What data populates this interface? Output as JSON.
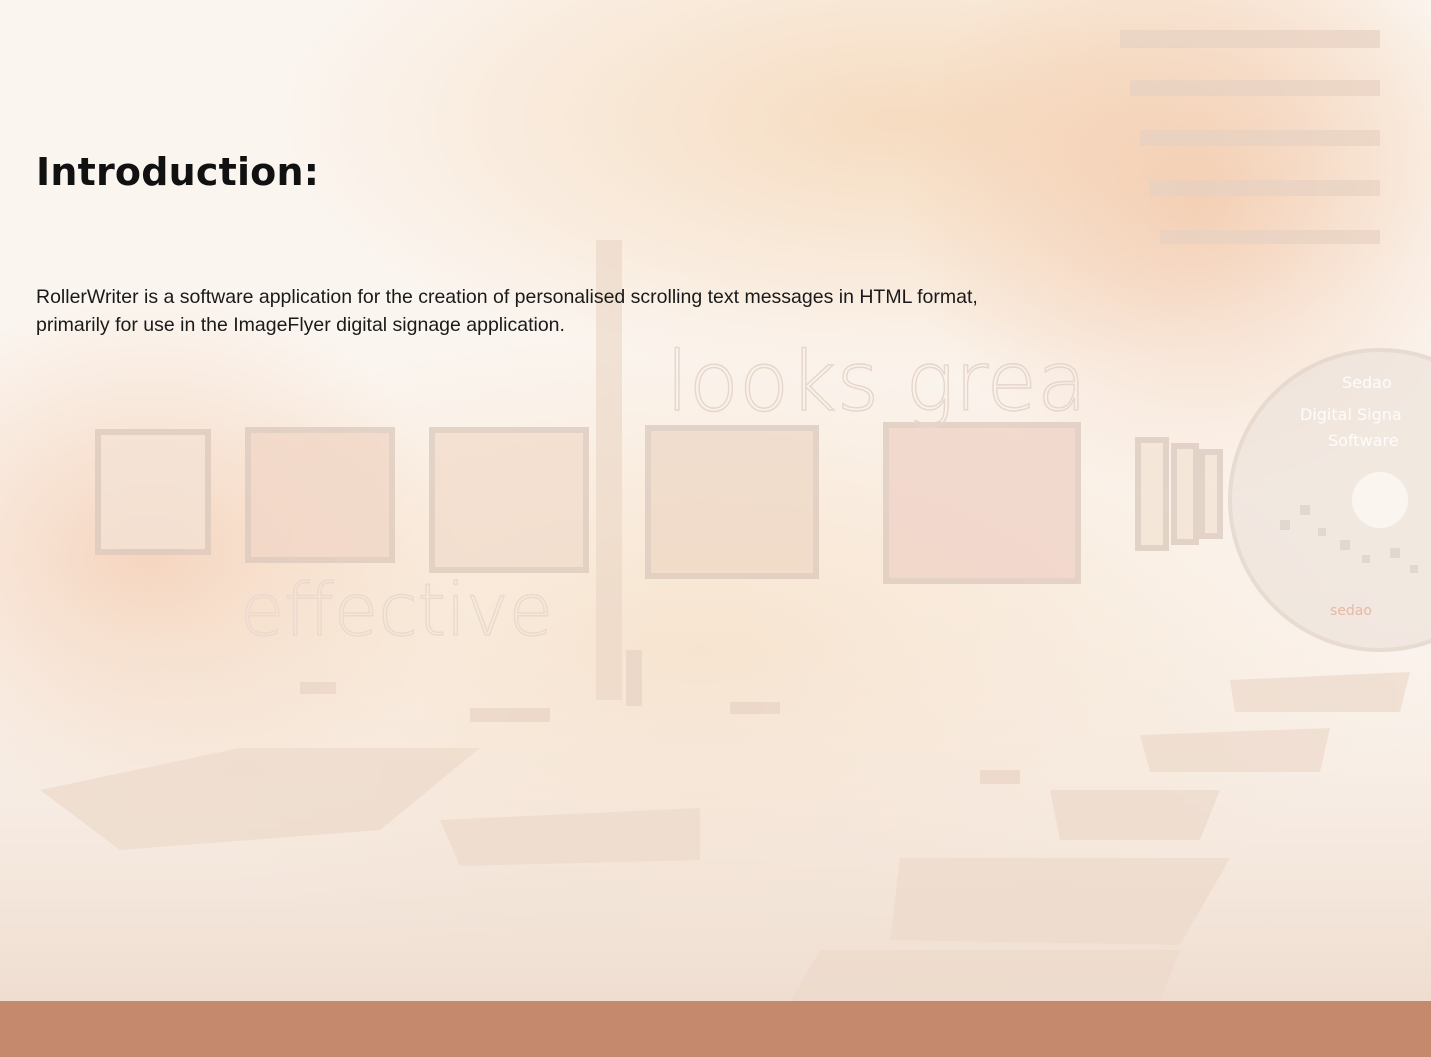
{
  "heading": "Introduction:",
  "body": {
    "line1": "RollerWriter is a software application for the creation of personalised scrolling text messages in HTML format,",
    "line2": "primarily for use in the ImageFlyer digital signage application."
  },
  "background": {
    "watermark_top": "looks grea",
    "watermark_bottom": "effective",
    "cd_line1": "Sedao",
    "cd_line2": "Digital Signa",
    "cd_line3": "Software",
    "cd_brand": "sedao"
  },
  "colors": {
    "footer_bar": "#c58a6e",
    "heading": "#111111",
    "text": "#1a1a1a"
  }
}
